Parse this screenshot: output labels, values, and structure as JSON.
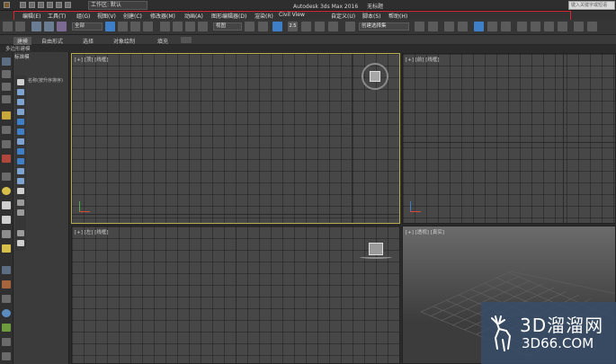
{
  "titlebar": {
    "workspace_label": "工作区: 默认",
    "app_title": "Autodesk 3ds Max 2016",
    "file_title": "无标题",
    "search_placeholder": "键入关键字或短语"
  },
  "menu": {
    "items": [
      "编辑(E)",
      "工具(T)",
      "组(G)",
      "视图(V)",
      "创建(C)",
      "修改器(M)",
      "动画(A)",
      "图形编辑器(D)",
      "渲染(R)",
      "Civil View",
      "自定义(U)",
      "脚本(S)",
      "帮助(H)"
    ],
    "highlight_color": "#d8262d"
  },
  "toolbar": {
    "selection_filter": "全部",
    "ref_coord": "视图",
    "snap_label": "2.5",
    "named_sel": "创建选择集"
  },
  "ribbon": {
    "tabs": [
      "建模",
      "自由形式",
      "选择",
      "对象绘制",
      "填充"
    ],
    "sub_label": "多边形建模"
  },
  "explorer": {
    "header": "标准模",
    "label": "名称(按升序排序)"
  },
  "viewports": {
    "top": "[+] [顶] [线框]",
    "front": "[+] [前] [线框]",
    "left": "[+] [左] [线框]",
    "persp": "[+] [透视] [真实]",
    "active_border": "#b8ad4f"
  },
  "watermark": {
    "name": "3D溜溜网",
    "domain": "3D66.COM"
  }
}
